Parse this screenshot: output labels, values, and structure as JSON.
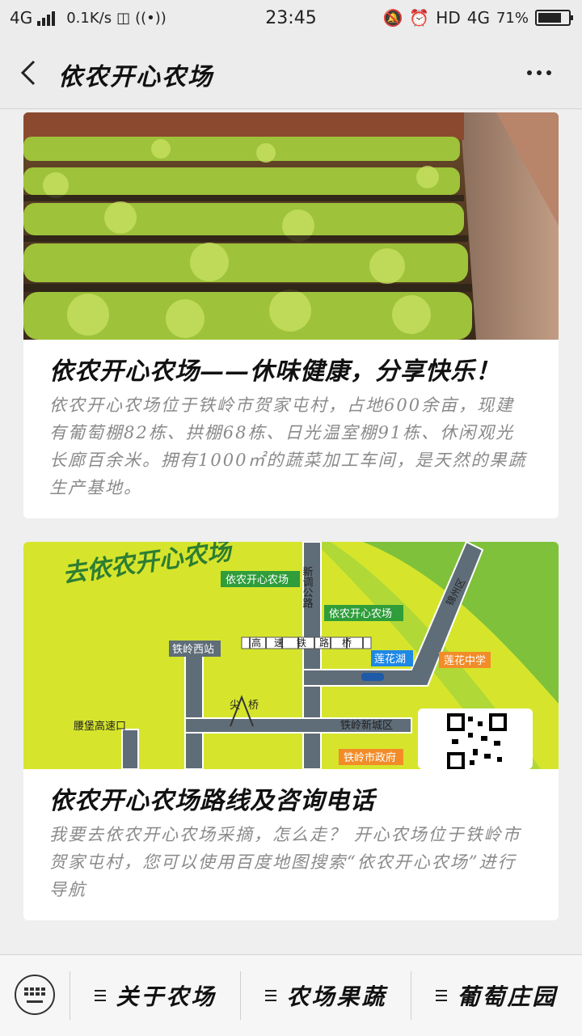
{
  "status_bar": {
    "network": "4G",
    "speed": "0.1K/s",
    "time": "23:45",
    "hd": "HD",
    "network_right": "4G",
    "battery": "71%"
  },
  "nav": {
    "title": "依农开心农场"
  },
  "cards": [
    {
      "title": "依农开心农场——休味健康，分享快乐！",
      "desc": "依农开心农场位于铁岭市贺家屯村，占地600余亩，现建有葡萄棚82栋、拱棚68栋、日光温室棚91栋、休闲观光长廊百余米。拥有1000㎡的蔬菜加工车间，是天然的果蔬生产基地。"
    },
    {
      "title": "依农开心农场路线及咨询电话",
      "desc": "我要去依农开心农场采摘，怎么走？ 开心农场位于铁岭市贺家屯村，您可以使用百度地图搜索“依农开心农场”进行导航"
    }
  ],
  "map": {
    "banner": "去依农开心农场",
    "labels": {
      "farm_top": "依农开心农场",
      "farm_mid": "依农开心农场",
      "road": "新调公路",
      "rail": "高速铁路桥",
      "lake": "莲花湖",
      "school": "莲花中学",
      "west_station": "铁岭西站",
      "bridge": "尖桥",
      "highway": "腰堡高速口",
      "new_city": "铁岭新城区",
      "gov": "铁岭市政府",
      "jinzhou": "锦州区"
    }
  },
  "bottom_menu": {
    "items": [
      "关于农场",
      "农场果蔬",
      "葡萄庄园"
    ]
  }
}
